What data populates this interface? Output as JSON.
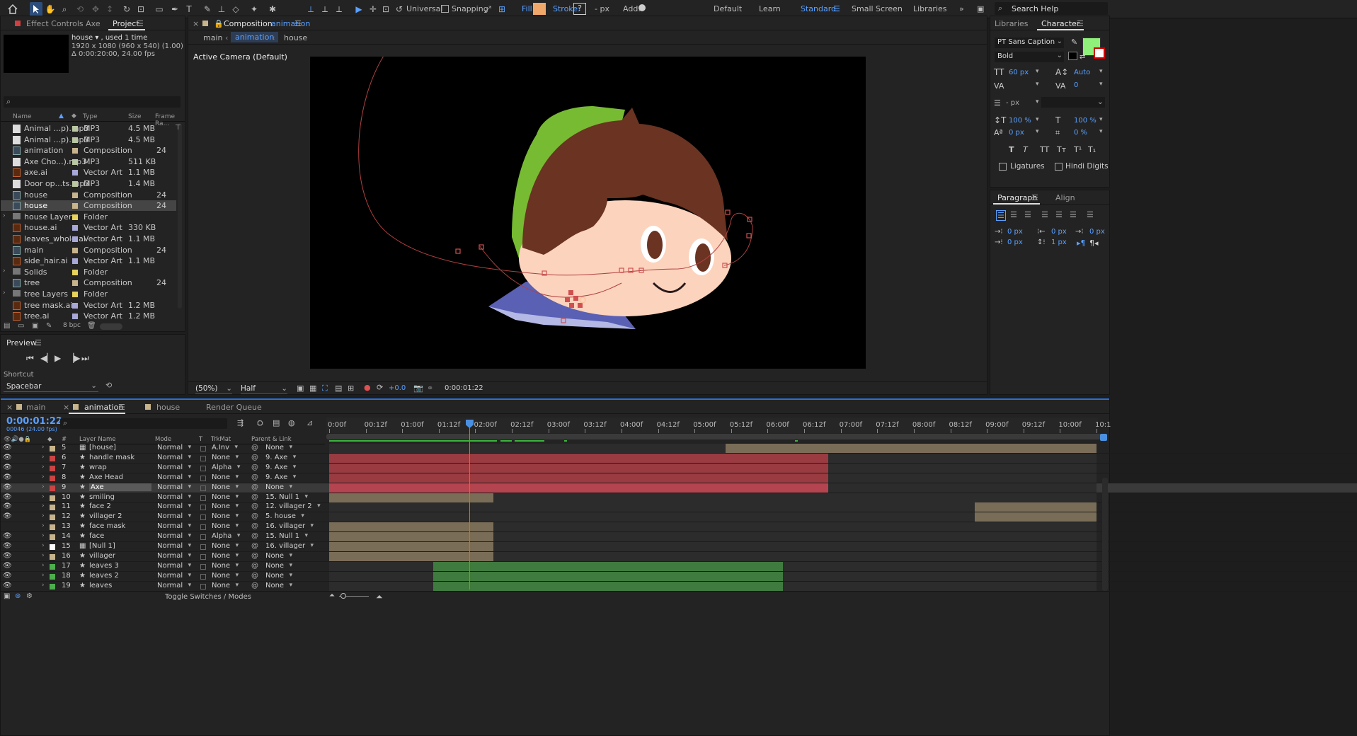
{
  "toolbar": {
    "universal": "Universal",
    "snapping": "Snapping",
    "fill": "Fill:",
    "stroke": "Stroke:",
    "stroke_px": "- px",
    "add": "Add:",
    "fill_color": "#f0a76a",
    "workspaces": [
      "Default",
      "Learn",
      "Standard",
      "Small Screen",
      "Libraries"
    ],
    "active_workspace": "Standard",
    "search_placeholder": "Search Help"
  },
  "project_panel": {
    "tab_effect": "Effect Controls Axe",
    "tab_project": "Project",
    "info_name": "house ▾ , used 1 time",
    "info_dims": "1920 x 1080  (960 x 540) (1.00)",
    "info_dur": "Δ 0:00:20:00, 24.00 fps",
    "columns": [
      "Name",
      "Type",
      "Size",
      "Frame Ra..."
    ],
    "items": [
      {
        "name": "Animal ...p).mp3",
        "type": "MP3",
        "size": "4.5 MB",
        "fps": "",
        "kind": "mp3",
        "color": "#b9c8a3"
      },
      {
        "name": "Animal ...p).mp3",
        "type": "MP3",
        "size": "4.5 MB",
        "fps": "",
        "kind": "mp3",
        "color": "#b9c8a3"
      },
      {
        "name": "animation",
        "type": "Composition",
        "size": "",
        "fps": "24",
        "kind": "comp",
        "color": "#c8b48c"
      },
      {
        "name": "Axe Cho...).mp3",
        "type": "MP3",
        "size": "511 KB",
        "fps": "",
        "kind": "mp3",
        "color": "#b9c8a3"
      },
      {
        "name": "axe.ai",
        "type": "Vector Art",
        "size": "1.1 MB",
        "fps": "",
        "kind": "ai",
        "color": "#a8a8d8"
      },
      {
        "name": "Door op...ts.mp3",
        "type": "MP3",
        "size": "1.4 MB",
        "fps": "",
        "kind": "mp3",
        "color": "#b9c8a3"
      },
      {
        "name": "house",
        "type": "Composition",
        "size": "",
        "fps": "24",
        "kind": "comp",
        "color": "#c8b48c"
      },
      {
        "name": "house",
        "type": "Composition",
        "size": "",
        "fps": "24",
        "kind": "comp",
        "color": "#c8b48c",
        "selected": true
      },
      {
        "name": "house Layers",
        "type": "Folder",
        "size": "",
        "fps": "",
        "kind": "fold",
        "color": "#e8d25a",
        "expand": true
      },
      {
        "name": "house.ai",
        "type": "Vector Art",
        "size": "330 KB",
        "fps": "",
        "kind": "ai",
        "color": "#a8a8d8"
      },
      {
        "name": "leaves_whole.ai",
        "type": "Vector Art",
        "size": "1.1 MB",
        "fps": "",
        "kind": "ai",
        "color": "#a8a8d8"
      },
      {
        "name": "main",
        "type": "Composition",
        "size": "",
        "fps": "24",
        "kind": "comp",
        "color": "#c8b48c"
      },
      {
        "name": "side_hair.ai",
        "type": "Vector Art",
        "size": "1.1 MB",
        "fps": "",
        "kind": "ai",
        "color": "#a8a8d8"
      },
      {
        "name": "Solids",
        "type": "Folder",
        "size": "",
        "fps": "",
        "kind": "fold",
        "color": "#e8d25a",
        "expand": true
      },
      {
        "name": "tree",
        "type": "Composition",
        "size": "",
        "fps": "24",
        "kind": "comp",
        "color": "#c8b48c"
      },
      {
        "name": "tree Layers",
        "type": "Folder",
        "size": "",
        "fps": "",
        "kind": "fold",
        "color": "#e8d25a",
        "expand": true
      },
      {
        "name": "tree mask.ai",
        "type": "Vector Art",
        "size": "1.2 MB",
        "fps": "",
        "kind": "ai",
        "color": "#a8a8d8"
      },
      {
        "name": "tree.ai",
        "type": "Vector Art",
        "size": "1.2 MB",
        "fps": "",
        "kind": "ai",
        "color": "#a8a8d8"
      }
    ],
    "bpc": "8 bpc"
  },
  "preview_panel": {
    "title": "Preview",
    "shortcut_label": "Shortcut",
    "shortcut_value": "Spacebar"
  },
  "composition": {
    "tab_label": "Composition",
    "tab_comp": "animation",
    "breadcrumb": [
      "main",
      "animation",
      "house"
    ],
    "camera": "Active Camera (Default)",
    "zoom": "(50%)",
    "resolution": "Half",
    "exposure": "+0.0",
    "timecode": "0:00:01:22"
  },
  "character_panel": {
    "tab_libraries": "Libraries",
    "tab_character": "Character",
    "font": "PT Sans Caption",
    "style": "Bold",
    "size": "60 px",
    "leading": "Auto",
    "kerning": "",
    "tracking": "0",
    "stroke_px": "- px",
    "vscale": "100 %",
    "hscale": "100 %",
    "baseline": "0 px",
    "tsume": "0 %",
    "ligatures": "Ligatures",
    "hindi": "Hindi Digits",
    "fill_color": "#8ff07a",
    "styles": [
      "T",
      "T",
      "TT",
      "Tт",
      "T¹",
      "T₁"
    ]
  },
  "paragraph_panel": {
    "tab_paragraph": "Paragraph",
    "tab_align": "Align",
    "indent_left": "0 px",
    "indent_right": "0 px",
    "indent_first": "0 px",
    "space_before": "0 px",
    "space_after": "1 px"
  },
  "timeline": {
    "tabs": [
      "main",
      "animation",
      "house",
      "Render Queue"
    ],
    "active_tab": "animation",
    "timecode": "0:00:01:22",
    "frame_info": "00046 (24.00 fps)",
    "col_layer_name": "Layer Name",
    "col_mode": "Mode",
    "col_t": "T",
    "col_trkmat": "TrkMat",
    "col_parent": "Parent & Link",
    "ruler": [
      "0:00f",
      "00:12f",
      "01:00f",
      "01:12f",
      "02:00f",
      "02:12f",
      "03:00f",
      "03:12f",
      "04:00f",
      "04:12f",
      "05:00f",
      "05:12f",
      "06:00f",
      "06:12f",
      "07:00f",
      "07:12f",
      "08:00f",
      "08:12f",
      "09:00f",
      "09:12f",
      "10:00f",
      "10:1"
    ],
    "playhead_seconds": 1.9167,
    "duration_seconds": 10.5,
    "layers": [
      {
        "num": "5",
        "name": "[house]",
        "label": "#c8b48c",
        "mode": "Normal",
        "trkmat": "A.Inv",
        "parent": "None",
        "start": 5.42,
        "end": 10.5,
        "barcolor": "#7a6d58",
        "eye": true
      },
      {
        "num": "6",
        "name": "handle mask",
        "label": "#cc4444",
        "mode": "Normal",
        "trkmat": "None",
        "parent": "9. Axe",
        "start": 0.0,
        "end": 6.83,
        "barcolor": "#9a3b42",
        "eye": true
      },
      {
        "num": "7",
        "name": "wrap",
        "label": "#cc4444",
        "mode": "Normal",
        "trkmat": "Alpha",
        "parent": "9. Axe",
        "start": 0.0,
        "end": 6.83,
        "barcolor": "#9a3b42",
        "eye": true
      },
      {
        "num": "8",
        "name": "Axe Head",
        "label": "#cc4444",
        "mode": "Normal",
        "trkmat": "None",
        "parent": "9. Axe",
        "start": 0.0,
        "end": 6.83,
        "barcolor": "#9a3b42",
        "eye": true
      },
      {
        "num": "9",
        "name": "Axe",
        "label": "#cc4444",
        "mode": "Normal",
        "trkmat": "None",
        "parent": "None",
        "start": 0.0,
        "end": 6.83,
        "barcolor": "#b44550",
        "eye": true,
        "selected": true
      },
      {
        "num": "10",
        "name": "smiling",
        "label": "#c8b48c",
        "mode": "Normal",
        "trkmat": "None",
        "parent": "15. Null 1",
        "start": 0.0,
        "end": 2.25,
        "barcolor": "#7a6d58",
        "eye": true
      },
      {
        "num": "11",
        "name": "face 2",
        "label": "#c8b48c",
        "mode": "Normal",
        "trkmat": "None",
        "parent": "12. villager 2",
        "start": 8.83,
        "end": 10.5,
        "barcolor": "#7a6d58",
        "eye": true
      },
      {
        "num": "12",
        "name": "villager 2",
        "label": "#c8b48c",
        "mode": "Normal",
        "trkmat": "None",
        "parent": "5. house",
        "start": 8.83,
        "end": 10.5,
        "barcolor": "#7a6d58",
        "eye": true
      },
      {
        "num": "13",
        "name": "face mask",
        "label": "#c8b48c",
        "mode": "Normal",
        "trkmat": "None",
        "parent": "16. villager",
        "start": 0.0,
        "end": 2.25,
        "barcolor": "#7a6d58",
        "eye": false
      },
      {
        "num": "14",
        "name": "face",
        "label": "#c8b48c",
        "mode": "Normal",
        "trkmat": "Alpha",
        "parent": "15. Null 1",
        "start": 0.0,
        "end": 2.25,
        "barcolor": "#7a6d58",
        "eye": true
      },
      {
        "num": "15",
        "name": "[Null 1]",
        "label": "#ffffff",
        "mode": "Normal",
        "trkmat": "None",
        "parent": "16. villager",
        "start": 0.0,
        "end": 2.25,
        "barcolor": "#7a6d58",
        "eye": true
      },
      {
        "num": "16",
        "name": "villager",
        "label": "#c8b48c",
        "mode": "Normal",
        "trkmat": "None",
        "parent": "None",
        "start": 0.0,
        "end": 2.25,
        "barcolor": "#7a6d58",
        "eye": true
      },
      {
        "num": "17",
        "name": "leaves 3",
        "label": "#4cae4c",
        "mode": "Normal",
        "trkmat": "None",
        "parent": "None",
        "start": 1.42,
        "end": 6.21,
        "barcolor": "#3f7a3f",
        "eye": true
      },
      {
        "num": "18",
        "name": "leaves 2",
        "label": "#4cae4c",
        "mode": "Normal",
        "trkmat": "None",
        "parent": "None",
        "start": 1.42,
        "end": 6.21,
        "barcolor": "#3f7a3f",
        "eye": true
      },
      {
        "num": "19",
        "name": "leaves",
        "label": "#4cae4c",
        "mode": "Normal",
        "trkmat": "None",
        "parent": "None",
        "start": 1.42,
        "end": 6.21,
        "barcolor": "#3f7a3f",
        "eye": true
      }
    ],
    "toggle_label": "Toggle Switches / Modes"
  }
}
